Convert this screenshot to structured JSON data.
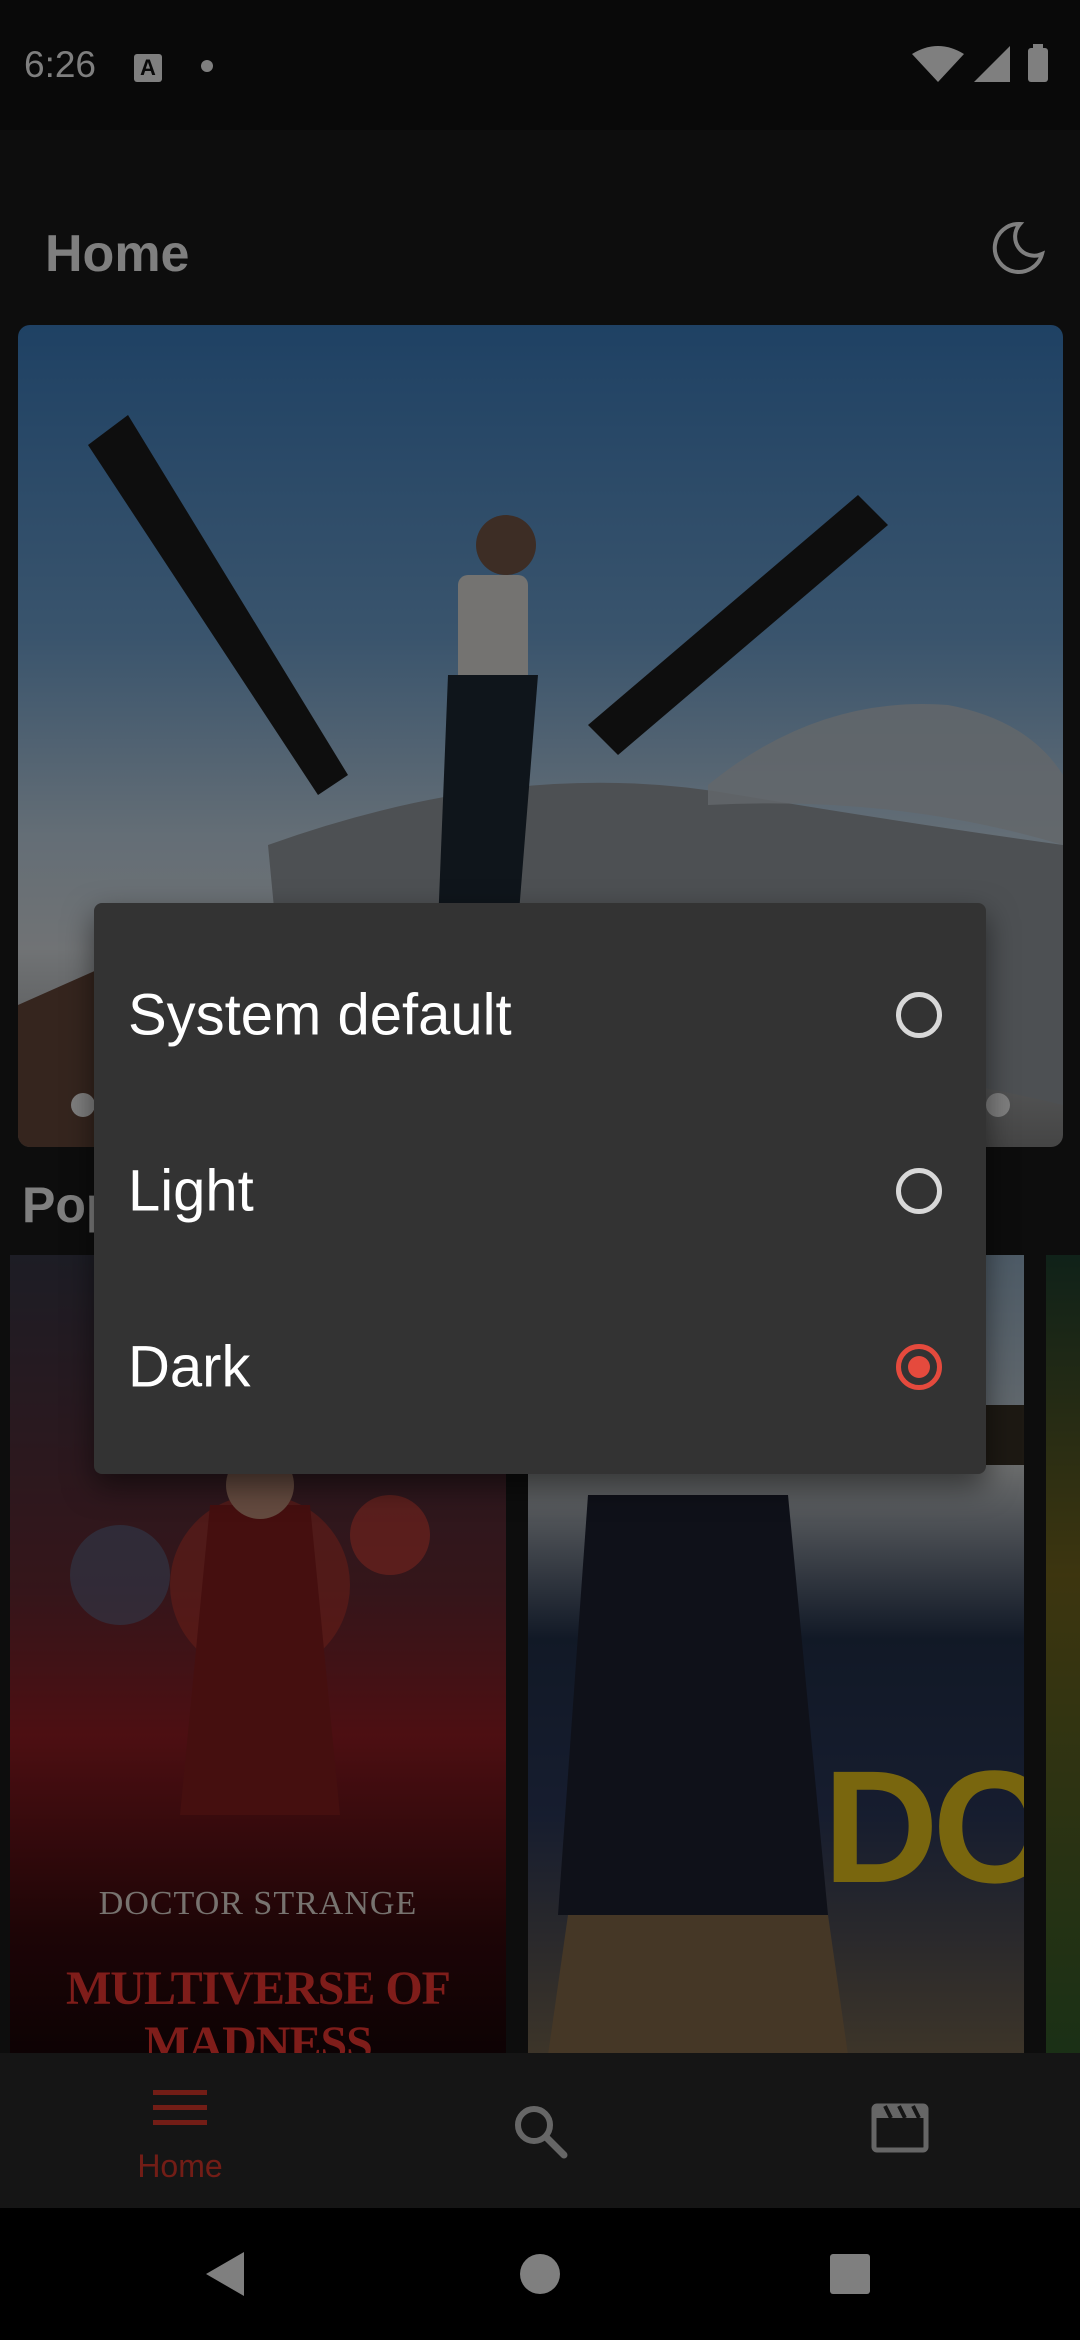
{
  "status_bar": {
    "time": "6:26",
    "notification_icon": "A"
  },
  "app_bar": {
    "title": "Home",
    "theme_icon": "moon-icon"
  },
  "home": {
    "section_title": "Popular"
  },
  "posters": [
    {
      "line1": "DOCTOR STRANGE",
      "line2": "MULTIVERSE OF MADNESS"
    },
    {
      "line1": "DOG"
    }
  ],
  "theme_dialog": {
    "options": [
      {
        "label": "System default",
        "selected": false
      },
      {
        "label": "Light",
        "selected": false
      },
      {
        "label": "Dark",
        "selected": true
      }
    ],
    "accent_color": "#e54a3d"
  },
  "bottom_nav": {
    "items": [
      {
        "label": "Home",
        "icon": "menu-icon",
        "active": true
      },
      {
        "label": "",
        "icon": "search-icon",
        "active": false
      },
      {
        "label": "",
        "icon": "movie-clapper-icon",
        "active": false
      }
    ]
  }
}
